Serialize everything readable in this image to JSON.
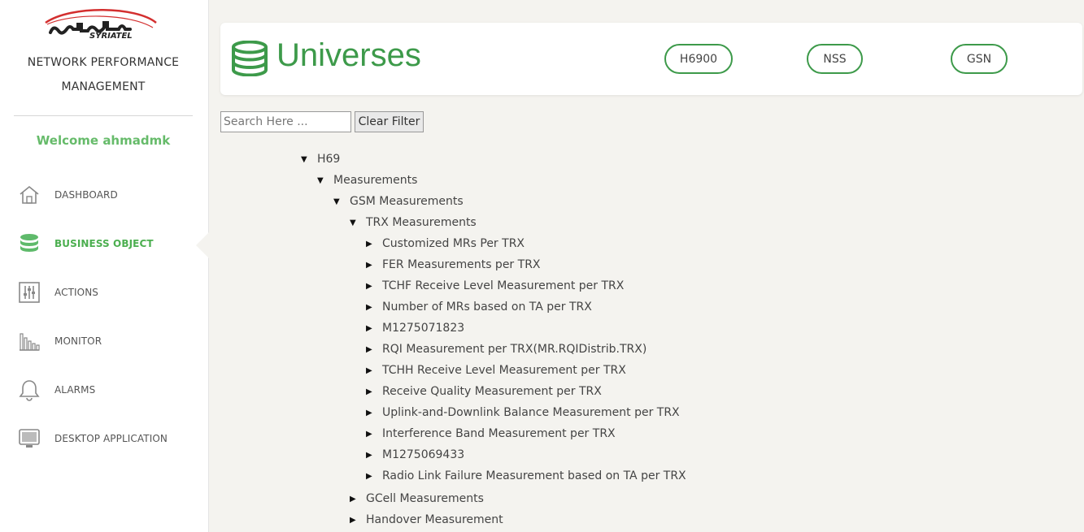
{
  "brand": {
    "logo_text": "SYRIATEL",
    "app_title_line1": "NETWORK PERFORMANCE",
    "app_title_line2": "MANAGEMENT",
    "welcome": "Welcome ahmadmk",
    "accent_color": "#3d9a4a"
  },
  "nav": {
    "items": [
      {
        "label": "DASHBOARD",
        "icon": "home-icon"
      },
      {
        "label": "BUSINESS OBJECT",
        "icon": "database-icon",
        "active": true
      },
      {
        "label": "ACTIONS",
        "icon": "sliders-icon"
      },
      {
        "label": "MONITOR",
        "icon": "bar-chart-icon"
      },
      {
        "label": "ALARMS",
        "icon": "bell-icon"
      },
      {
        "label": "DESKTOP APPLICATION",
        "icon": "monitor-icon"
      }
    ]
  },
  "header": {
    "title": "Universes",
    "icon": "database-icon",
    "buttons": [
      {
        "label": "H6900"
      },
      {
        "label": "NSS"
      },
      {
        "label": "GSN"
      }
    ]
  },
  "search": {
    "placeholder": "Search Here ...",
    "clear_label": "Clear Filter"
  },
  "tree": [
    {
      "label": "H69",
      "expanded": true
    },
    {
      "label": "Measurements",
      "expanded": true
    },
    {
      "label": "GSM Measurements",
      "expanded": true
    },
    {
      "label": "TRX Measurements",
      "expanded": true
    },
    {
      "label": "Customized MRs Per TRX",
      "expanded": false
    },
    {
      "label": "FER Measurements per TRX",
      "expanded": false
    },
    {
      "label": "TCHF Receive Level Measurement per TRX",
      "expanded": false
    },
    {
      "label": "Number of MRs based on TA per TRX",
      "expanded": false
    },
    {
      "label": "M1275071823",
      "expanded": false
    },
    {
      "label": "RQI Measurement per TRX(MR.RQIDistrib.TRX)",
      "expanded": false
    },
    {
      "label": "TCHH Receive Level Measurement per TRX",
      "expanded": false
    },
    {
      "label": "Receive Quality Measurement per TRX",
      "expanded": false
    },
    {
      "label": "Uplink-and-Downlink Balance Measurement per TRX",
      "expanded": false
    },
    {
      "label": "Interference Band Measurement per TRX",
      "expanded": false
    },
    {
      "label": "M1275069433",
      "expanded": false
    },
    {
      "label": "Radio Link Failure Measurement based on TA per TRX",
      "expanded": false
    },
    {
      "label": "GCell Measurements",
      "expanded": false
    },
    {
      "label": "Handover Measurement",
      "expanded": false
    }
  ]
}
